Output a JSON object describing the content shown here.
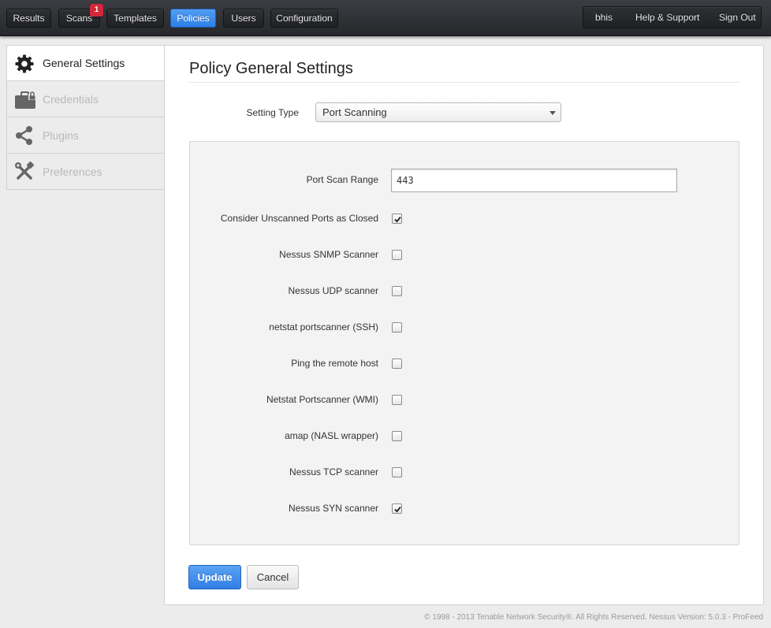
{
  "nav": {
    "items": [
      {
        "label": "Results",
        "active": false
      },
      {
        "label": "Scans",
        "active": false,
        "badge": "1"
      },
      {
        "label": "Templates",
        "active": false
      },
      {
        "label": "Policies",
        "active": true
      },
      {
        "label": "Users",
        "active": false
      },
      {
        "label": "Configuration",
        "active": false
      }
    ],
    "user": "bhis",
    "help": "Help & Support",
    "signout": "Sign Out"
  },
  "sidebar": {
    "items": [
      {
        "label": "General Settings",
        "icon": "gear-icon",
        "active": true
      },
      {
        "label": "Credentials",
        "icon": "briefcase-lock-icon",
        "active": false
      },
      {
        "label": "Plugins",
        "icon": "share-icon",
        "active": false
      },
      {
        "label": "Preferences",
        "icon": "tools-icon",
        "active": false
      }
    ]
  },
  "main": {
    "title": "Policy General Settings",
    "setting_type_label": "Setting Type",
    "setting_type_value": "Port Scanning",
    "port_scan_range_label": "Port Scan Range",
    "port_scan_range_value": "443",
    "options": [
      {
        "label": "Consider Unscanned Ports as Closed",
        "checked": true
      },
      {
        "label": "Nessus SNMP Scanner",
        "checked": false
      },
      {
        "label": "Nessus UDP scanner",
        "checked": false
      },
      {
        "label": "netstat portscanner (SSH)",
        "checked": false
      },
      {
        "label": "Ping the remote host",
        "checked": false
      },
      {
        "label": "Netstat Portscanner (WMI)",
        "checked": false
      },
      {
        "label": "amap (NASL wrapper)",
        "checked": false
      },
      {
        "label": "Nessus TCP scanner",
        "checked": false
      },
      {
        "label": "Nessus SYN scanner",
        "checked": true
      }
    ],
    "update_label": "Update",
    "cancel_label": "Cancel"
  },
  "footer": "© 1998 - 2013 Tenable Network Security®. All Rights Reserved. Nessus Version: 5.0.3 - ProFeed",
  "colors": {
    "accent": "#2f7ee4",
    "badge": "#d6263b",
    "topbar": "#2a2c30"
  }
}
